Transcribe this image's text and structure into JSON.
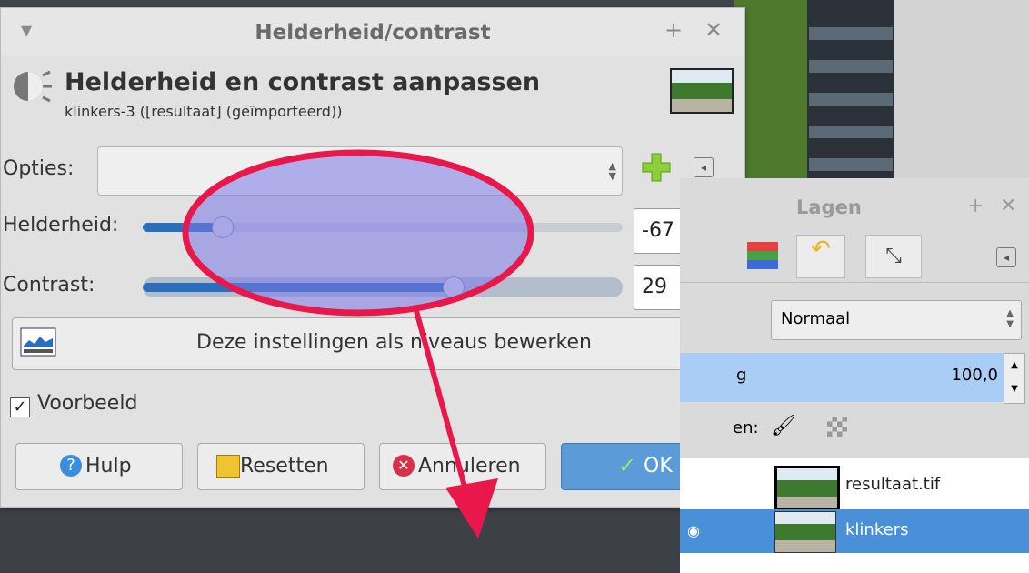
{
  "dialog": {
    "title": "Helderheid/contrast",
    "heading": "Helderheid en contrast aanpassen",
    "subheading": "klinkers-3 ([resultaat] (geïmporteerd))",
    "options_label": "Opties:",
    "options_value": "",
    "brightness": {
      "label": "Helderheid:",
      "value": "-67",
      "level": -0.67
    },
    "contrast": {
      "label": "Contrast:",
      "value": "29",
      "level": 0.29
    },
    "levels_button": "Deze instellingen als niveaus bewerken",
    "preview_label": "Voorbeeld",
    "preview_checked": true,
    "buttons": {
      "help": "Hulp",
      "reset": "Resetten",
      "cancel": "Annuleren",
      "ok": "OK"
    }
  },
  "layers_panel": {
    "title": "Lagen",
    "mode": "Normaal",
    "opacity_label_partial": "g",
    "opacity_value": "100,0",
    "lock_label_partial": "en:",
    "layers": [
      {
        "name": "resultaat.tif",
        "selected": false
      },
      {
        "name": "klinkers",
        "selected": true
      }
    ]
  },
  "colors": {
    "annotation": "#e8184a",
    "highlight_fill": "#7a79e8",
    "selection": "#4a90d9"
  }
}
